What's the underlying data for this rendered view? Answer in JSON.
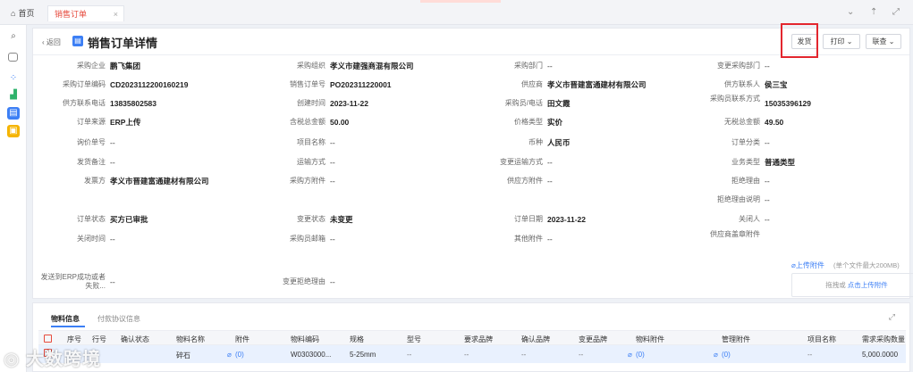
{
  "topbar": {
    "home_label": "首页",
    "active_tab_label": "销售订单",
    "close_glyph": "×"
  },
  "header": {
    "back_label": "返回",
    "title": "销售订单详情",
    "ship_button": "发货",
    "print_button": "打印",
    "contact_button": "联查"
  },
  "details": [
    {
      "label": "采购企业",
      "value": "鹏飞集团",
      "bold": true
    },
    {
      "label": "采购组织",
      "value": "孝义市建强商混有限公司",
      "bold": true
    },
    {
      "label": "采购部门",
      "value": "--",
      "bold": false
    },
    {
      "label": "变更采购部门",
      "value": "--",
      "bold": false
    },
    {
      "label": "采购订单编码",
      "value": "CD2023112200160219",
      "bold": true
    },
    {
      "label": "销售订单号",
      "value": "PO202311220001",
      "bold": true
    },
    {
      "label": "供应商",
      "value": "孝义市晋建富通建材有限公司",
      "bold": true
    },
    {
      "label": "供方联系人",
      "value": "侯三宝",
      "bold": true
    },
    {
      "label": "供方联系电话",
      "value": "13835802583",
      "bold": true
    },
    {
      "label": "创建时间",
      "value": "2023-11-22",
      "bold": true
    },
    {
      "label": "采购员/电话",
      "value": "田文霞",
      "bold": true
    },
    {
      "label": "采购员联系方式",
      "value": "15035396129",
      "bold": true
    },
    {
      "label": "订单来源",
      "value": "ERP上传",
      "bold": true
    },
    {
      "label": "含税总金额",
      "value": "50.00",
      "bold": true
    },
    {
      "label": "价格类型",
      "value": "实价",
      "bold": true
    },
    {
      "label": "无税总金额",
      "value": "49.50",
      "bold": true
    },
    {
      "label": "询价单号",
      "value": "--",
      "bold": false
    },
    {
      "label": "项目名称",
      "value": "--",
      "bold": false
    },
    {
      "label": "币种",
      "value": "人民币",
      "bold": true
    },
    {
      "label": "订单分类",
      "value": "--",
      "bold": false
    },
    {
      "label": "发货备注",
      "value": "--",
      "bold": false
    },
    {
      "label": "运输方式",
      "value": "--",
      "bold": false
    },
    {
      "label": "变更运输方式",
      "value": "--",
      "bold": false
    },
    {
      "label": "业务类型",
      "value": "普通类型",
      "bold": true
    },
    {
      "label": "发票方",
      "value": "孝义市晋建富通建材有限公司",
      "bold": true
    },
    {
      "label": "采购方附件",
      "value": "--",
      "bold": false
    },
    {
      "label": "供应方附件",
      "value": "--",
      "bold": false
    },
    {
      "label": "拒绝理由",
      "value": "--",
      "bold": false
    },
    {
      "label": "拒绝理由说明",
      "value": "--",
      "bold": false
    },
    {
      "label": "订单状态",
      "value": "买方已审批",
      "bold": true
    },
    {
      "label": "变更状态",
      "value": "未变更",
      "bold": true
    },
    {
      "label": "订单日期",
      "value": "2023-11-22",
      "bold": true
    },
    {
      "label": "关闭人",
      "value": "--",
      "bold": false
    },
    {
      "label": "关闭时间",
      "value": "--",
      "bold": false
    },
    {
      "label": "采购员邮箱",
      "value": "--",
      "bold": false
    },
    {
      "label": "其他附件",
      "value": "--",
      "bold": false
    },
    {
      "label": "供应商盖章附件",
      "value": "",
      "bold": false
    },
    {
      "label": "发送到ERP成功或者失败...",
      "value": "--",
      "bold": false
    },
    {
      "label": "变更拒绝理由",
      "value": "--",
      "bold": false
    }
  ],
  "upload": {
    "link": "上传附件",
    "hint": "(单个文件最大200MB)",
    "drop_prefix": "拖拽或",
    "drop_link": "点击上传附件"
  },
  "lower": {
    "tabs": [
      "物料信息",
      "付款协议信息"
    ],
    "columns": [
      "序号",
      "行号",
      "确认状态",
      "物料名称",
      "附件",
      "物料编码",
      "规格",
      "型号",
      "要求品牌",
      "确认品牌",
      "变更品牌",
      "物料附件",
      "管理附件",
      "项目名称",
      "需求采购数量"
    ],
    "rows": [
      {
        "cells": [
          "",
          "",
          "",
          "碎石",
          "(0)",
          "W0303000...",
          "5-25mm",
          "--",
          "--",
          "--",
          "--",
          "(0)",
          "(0)",
          "--",
          "5,000.0000"
        ]
      }
    ]
  },
  "watermark": "大数跨境",
  "colors": {
    "accent": "#3c7ff5",
    "active_tab": "#e64a3c",
    "highlight": "#e3262e",
    "row_selected": "#e9f1fe"
  }
}
